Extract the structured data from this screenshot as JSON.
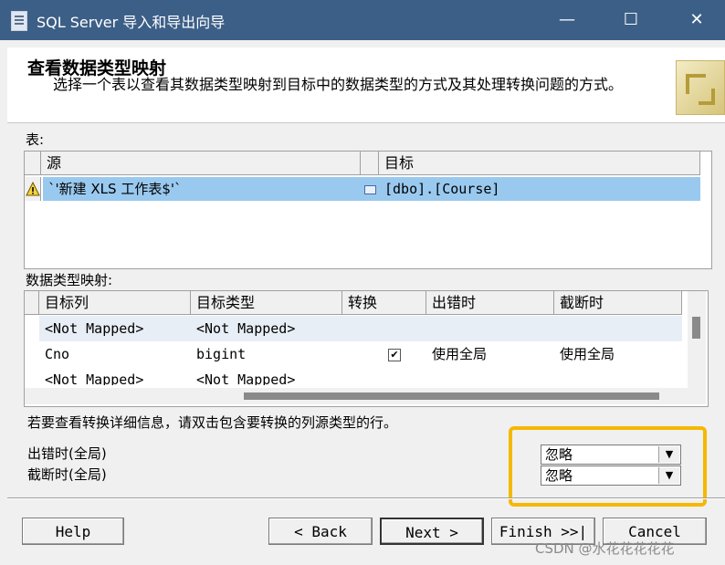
{
  "window": {
    "title": "SQL Server 导入和导出向导",
    "minimize": "—",
    "maximize": "☐",
    "close": "✕"
  },
  "header": {
    "title": "查看数据类型映射",
    "description": "选择一个表以查看其数据类型映射到目标中的数据类型的方式及其处理转换问题的方式。"
  },
  "tables": {
    "label": "表:",
    "columns": [
      "源",
      "目标"
    ],
    "rows": [
      {
        "status": "warning",
        "source": "`'新建 XLS 工作表$'`",
        "destination": "[dbo].[Course]"
      }
    ]
  },
  "mapping": {
    "label": "数据类型映射:",
    "columns": [
      "目标列",
      "目标类型",
      "转换",
      "出错时",
      "截断时"
    ],
    "rows": [
      {
        "target_column": "<Not Mapped>",
        "target_type": "<Not Mapped>",
        "convert": false,
        "on_error": "",
        "on_truncate": ""
      },
      {
        "target_column": "Cno",
        "target_type": "bigint",
        "convert": true,
        "on_error": "使用全局",
        "on_truncate": "使用全局"
      },
      {
        "target_column": "<Not Mapped>",
        "target_type": "<Not Mapped>",
        "convert": false,
        "on_error": "",
        "on_truncate": ""
      }
    ]
  },
  "hint": "若要查看转换详细信息，请双击包含要转换的列源类型的行。",
  "global": {
    "on_error_label": "出错时(全局)",
    "on_truncate_label": "截断时(全局)",
    "on_error_value": "忽略",
    "on_truncate_value": "忽略"
  },
  "buttons": {
    "help": "Help",
    "back": "< Back",
    "next": "Next >",
    "finish": "Finish >>|",
    "cancel": "Cancel"
  },
  "watermark": "CSDN @水花花花花花",
  "colors": {
    "titlebar": "#3c5f87",
    "selected_row": "#99c9ef",
    "highlight_box": "#f5b800"
  }
}
